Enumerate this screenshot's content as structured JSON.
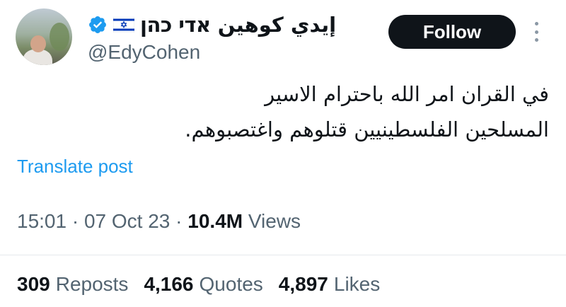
{
  "author": {
    "display_name": "إيدي كوهين אדי כהן",
    "handle": "@EdyCohen",
    "flag_icon": "israel-flag-icon",
    "verified_icon": "verified-badge-icon",
    "verified_color": "#1d9bf0"
  },
  "follow_label": "Follow",
  "tweet": {
    "lines": [
      "في القران امر الله باحترام الاسير",
      "المسلحين الفلسطينيين قتلوهم واغتصبوهم."
    ]
  },
  "translate_label": "Translate post",
  "meta": {
    "time": "15:01",
    "sep1": "·",
    "date": "07 Oct 23",
    "sep2": "·",
    "views_count": "10.4M",
    "views_label": "Views"
  },
  "stats": [
    {
      "count": "309",
      "label": "Reposts"
    },
    {
      "count": "4,166",
      "label": "Quotes"
    },
    {
      "count": "4,897",
      "label": "Likes"
    }
  ],
  "colors": {
    "link": "#1d9bf0",
    "secondary_text": "#536471",
    "primary_text": "#0f1419",
    "button_bg": "#0f1419"
  }
}
